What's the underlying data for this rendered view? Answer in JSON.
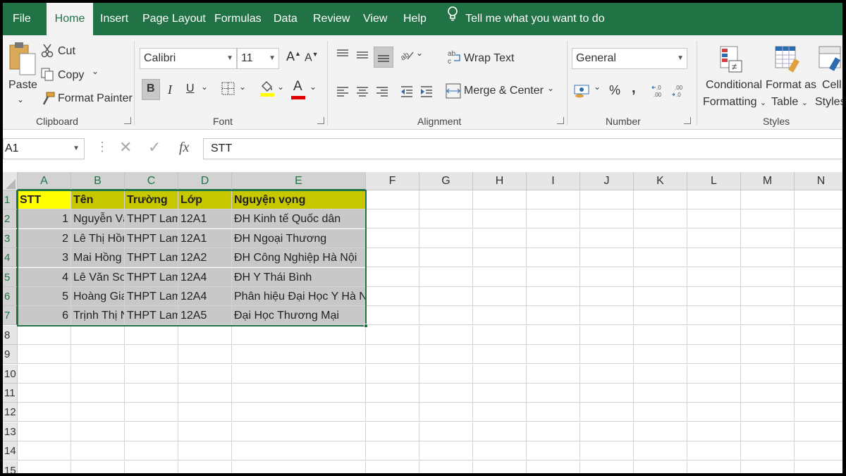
{
  "menu": {
    "tabs": [
      "File",
      "Home",
      "Insert",
      "Page Layout",
      "Formulas",
      "Data",
      "Review",
      "View",
      "Help"
    ],
    "active": "Home",
    "tell_me": "Tell me what you want to do"
  },
  "ribbon": {
    "clipboard": {
      "paste": "Paste",
      "cut": "Cut",
      "copy": "Copy",
      "format_painter": "Format Painter",
      "label": "Clipboard"
    },
    "font": {
      "name": "Calibri",
      "size": "11",
      "bold": "B",
      "italic": "I",
      "underline": "U",
      "grow": "A",
      "shrink": "A",
      "font_color": "A",
      "label": "Font",
      "fill_color": "#ffff00",
      "text_color": "#e00000"
    },
    "alignment": {
      "wrap_text": "Wrap Text",
      "merge_center": "Merge & Center",
      "label": "Alignment"
    },
    "number": {
      "format": "General",
      "percent": "%",
      "comma": ",",
      "label": "Number"
    },
    "styles": {
      "conditional_line1": "Conditional",
      "conditional_line2": "Formatting",
      "format_table_line1": "Format as",
      "format_table_line2": "Table",
      "cell_styles_line1": "Cell",
      "cell_styles_line2": "Styles",
      "label": "Styles"
    }
  },
  "formula_bar": {
    "name_box": "A1",
    "fx": "fx",
    "content": "STT"
  },
  "sheet": {
    "columns": [
      "A",
      "B",
      "C",
      "D",
      "E",
      "F",
      "G",
      "H",
      "I",
      "J",
      "K",
      "L",
      "M",
      "N"
    ],
    "rows": [
      "1",
      "2",
      "3",
      "4",
      "5",
      "6",
      "7",
      "8",
      "9",
      "10",
      "11",
      "12",
      "13",
      "14",
      "15"
    ],
    "header": [
      "STT",
      "Tên",
      "Trường",
      "Lớp",
      "Nguyện vọng"
    ],
    "data": [
      [
        "1",
        "Nguyễn Vă",
        "THPT Lam",
        "12A1",
        "ĐH Kinh tế Quốc dân"
      ],
      [
        "2",
        "Lê Thị Hồn",
        "THPT Lam",
        "12A1",
        "ĐH Ngoại Thương"
      ],
      [
        "3",
        "Mai Hồng",
        "THPT Lam",
        "12A2",
        "ĐH Công Nghiệp Hà Nội"
      ],
      [
        "4",
        "Lê Văn Sơn",
        "THPT Lam",
        "12A4",
        "ĐH Y Thái Bình"
      ],
      [
        "5",
        "Hoàng Gia",
        "THPT Lam",
        "12A4",
        "Phân hiệu Đại Học Y Hà Nộ"
      ],
      [
        "6",
        "Trịnh Thị N",
        "THPT Lam",
        "12A5",
        "Đại Học Thương Mại"
      ]
    ],
    "colors": {
      "header_a": "#ffff00",
      "header_rest": "#c8c800",
      "data_fill": "#c8c8c8",
      "accent": "#217346"
    }
  }
}
